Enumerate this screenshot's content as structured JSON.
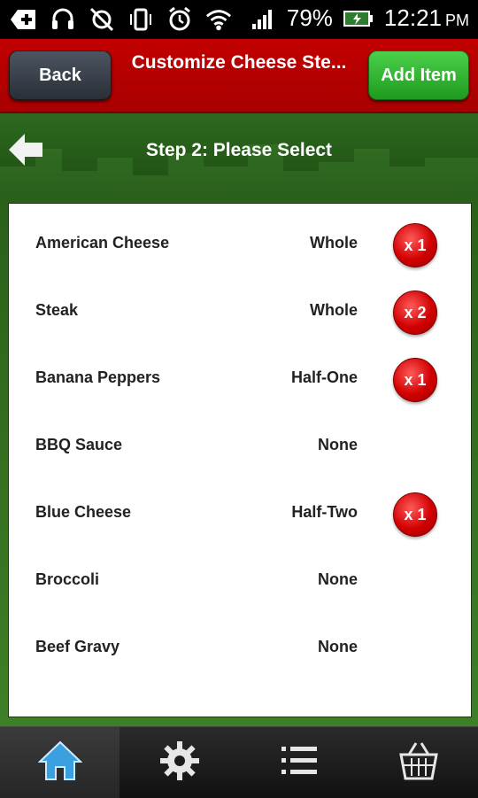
{
  "status_bar": {
    "battery": "79%",
    "time": "12:21",
    "ampm": "PM",
    "icons": [
      "notification-plus-icon",
      "headset-icon",
      "sync-off-icon",
      "vibrate-icon",
      "alarm-icon",
      "wifi-icon",
      "signal-icon",
      "battery-icon"
    ]
  },
  "header": {
    "back_label": "Back",
    "title": "Customize Cheese Ste...",
    "add_label": "Add Item"
  },
  "step": {
    "title": "Step 2: Please Select"
  },
  "items": [
    {
      "name": "American Cheese",
      "portion": "Whole",
      "qty": "x 1"
    },
    {
      "name": "Steak",
      "portion": "Whole",
      "qty": "x 2"
    },
    {
      "name": "Banana Peppers",
      "portion": "Half-One",
      "qty": "x 1"
    },
    {
      "name": "BBQ Sauce",
      "portion": "None",
      "qty": ""
    },
    {
      "name": "Blue Cheese",
      "portion": "Half-Two",
      "qty": "x 1"
    },
    {
      "name": "Broccoli",
      "portion": "None",
      "qty": ""
    },
    {
      "name": "Beef Gravy",
      "portion": "None",
      "qty": ""
    }
  ],
  "bottom_nav": [
    "home-icon",
    "settings-gear-icon",
    "list-icon",
    "basket-icon"
  ],
  "colors": {
    "header_red": "#b80000",
    "add_green": "#2bb52b",
    "step_green": "#2d6a1f",
    "badge_red": "#d10000"
  }
}
